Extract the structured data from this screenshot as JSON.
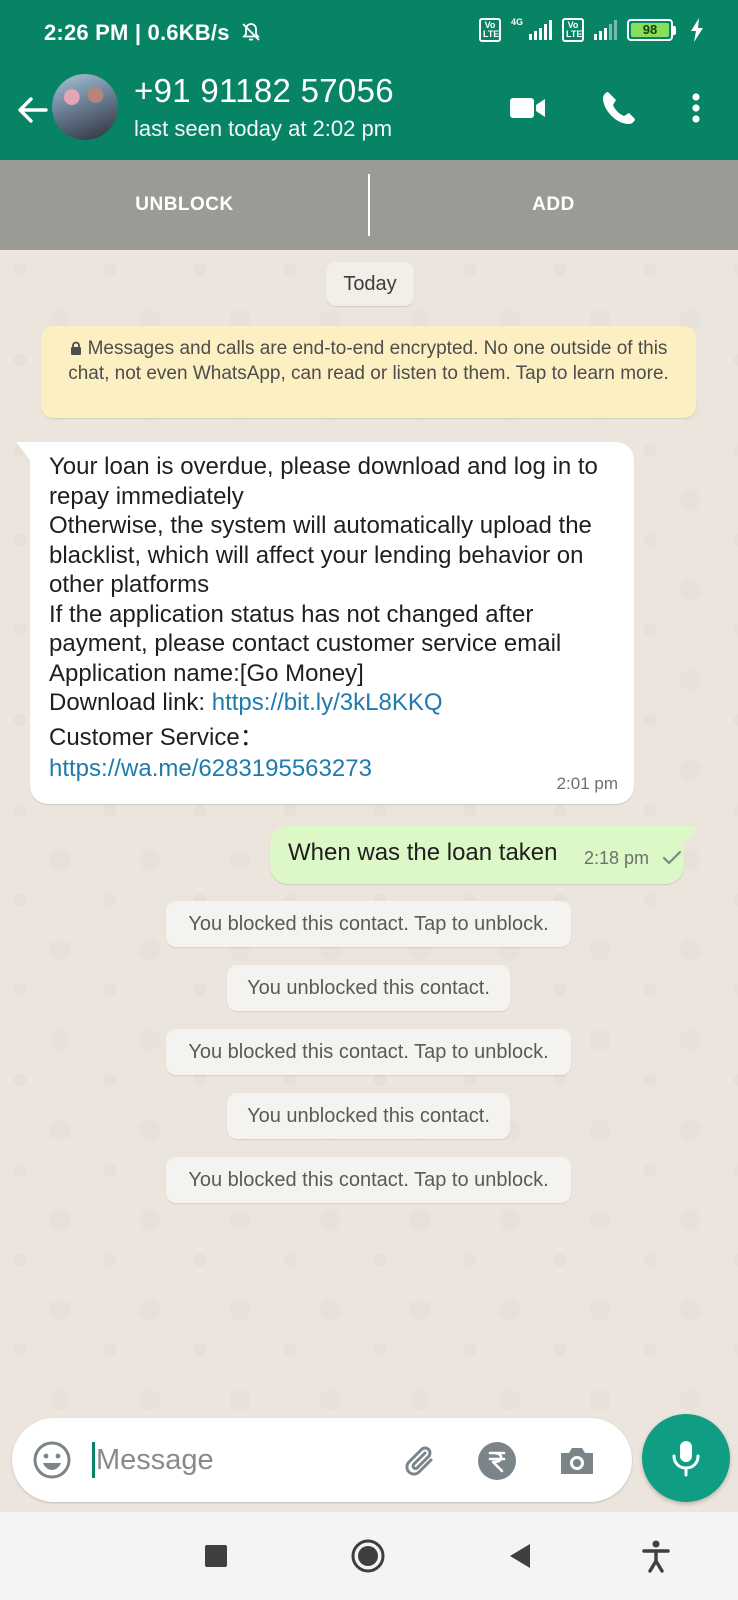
{
  "status_bar": {
    "time": "2:26 PM | 0.6KB/s",
    "network_label": "4G",
    "lte_label": "Vo LTE",
    "battery_level": "98"
  },
  "header": {
    "contact_name": "+91 91182 57056",
    "last_seen": "last seen today at 2:02 pm"
  },
  "block_bar": {
    "unblock_label": "UNBLOCK",
    "add_label": "ADD"
  },
  "chat": {
    "date_chip": "Today",
    "encryption_notice": "Messages and calls are end-to-end encrypted. No one outside of this chat, not even WhatsApp, can read or listen to them. Tap to learn more.",
    "incoming": {
      "body": "Your loan is overdue, please download and log in to repay immediately\nOtherwise, the system will automatically upload the blacklist, which will affect your lending behavior on other platforms\nIf the application status has not changed after payment, please contact customer service email",
      "app_name_line": "Application name:[Go Money]",
      "download_label": "Download link: ",
      "download_link": "https://bit.ly/3kL8KKQ",
      "cs_label": "Customer Service：",
      "cs_link": "https://wa.me/6283195563273",
      "time": "2:01 pm"
    },
    "outgoing": {
      "text": "When was the loan taken",
      "time": "2:18 pm"
    },
    "system_messages": [
      "You blocked this contact. Tap to unblock.",
      "You unblocked this contact.",
      "You blocked this contact. Tap to unblock.",
      "You unblocked this contact.",
      "You blocked this contact. Tap to unblock."
    ]
  },
  "composer": {
    "placeholder": "Message"
  },
  "colors": {
    "header": "#078466",
    "mic": "#0f9e83",
    "outgoing_bubble": "#dcf8c6",
    "encryption_notice": "#fcf0c3",
    "link": "#1f7aad"
  },
  "icons": {
    "header": [
      "back-arrow-icon",
      "video-call-icon",
      "voice-call-icon",
      "more-options-icon"
    ],
    "composer": [
      "emoji-icon",
      "attach-icon",
      "rupee-payment-icon",
      "camera-icon",
      "mic-icon"
    ],
    "nav": [
      "recents-icon",
      "home-icon",
      "back-icon",
      "accessibility-icon"
    ]
  }
}
